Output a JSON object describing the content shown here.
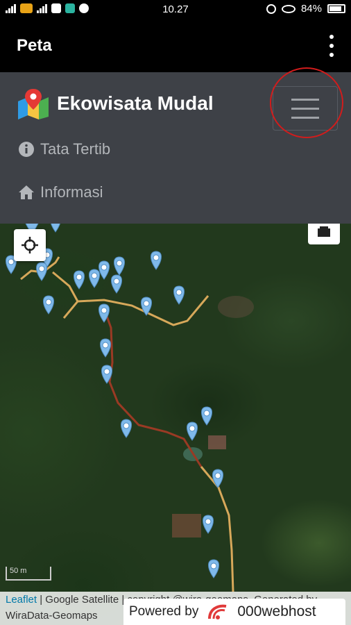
{
  "status_bar": {
    "time": "10.27",
    "battery": "84%"
  },
  "app_bar": {
    "title": "Peta"
  },
  "navbar": {
    "brand": "Ekowisata Mudal",
    "items": [
      {
        "label": "Tata Tertib",
        "icon": "info-circle-icon"
      },
      {
        "label": "Informasi",
        "icon": "home-icon"
      }
    ]
  },
  "map": {
    "scale_label": "50 m",
    "attribution": {
      "link": "Leaflet",
      "text": " | Google Satellite | copyright @wira-geomaps, Generated by WiraData-Geomaps"
    },
    "powered_by": {
      "label": "Powered by",
      "brand": "000webhost"
    },
    "marker_color": "#7fb9ea",
    "route_colors": {
      "main_path": "#d7a85a",
      "red_path": "#9a3a24"
    }
  },
  "colors": {
    "navbar_bg": "#3e4147",
    "highlight": "#d11c1c"
  }
}
